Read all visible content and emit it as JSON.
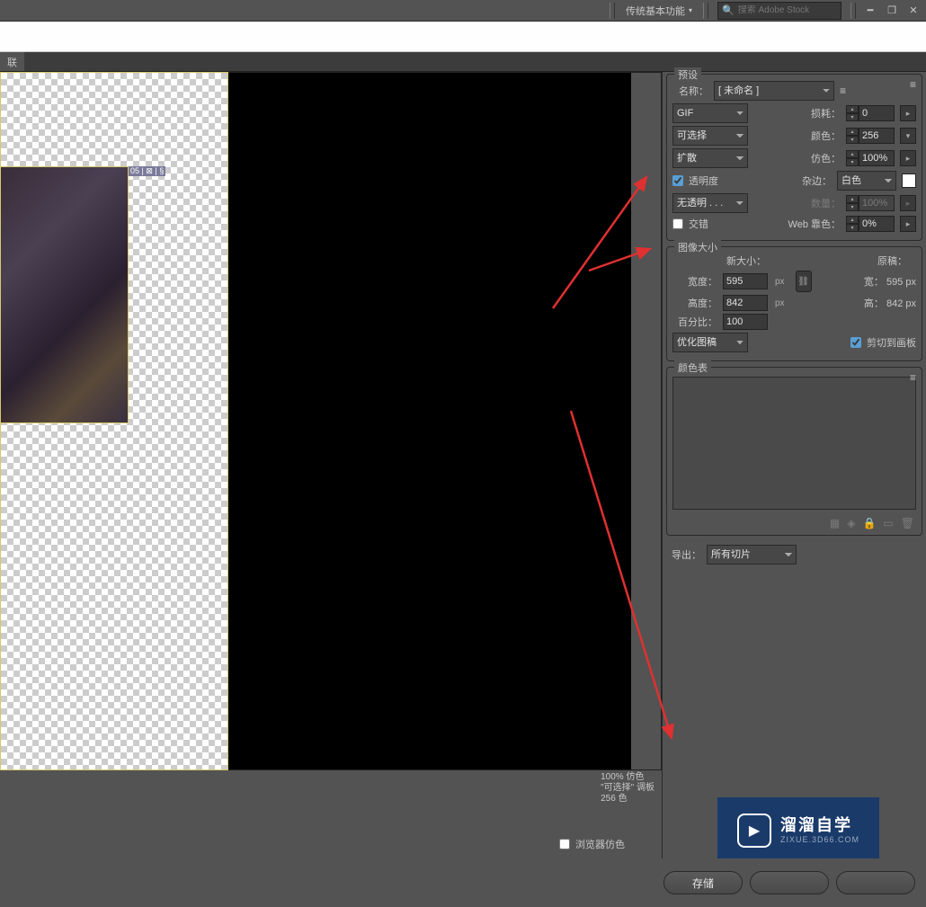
{
  "topbar": {
    "workspace": "传统基本功能",
    "search_placeholder": "搜索 Adobe Stock"
  },
  "tab": {
    "label": "联"
  },
  "canvas": {
    "slice_badge": "05 | ⊠ | §"
  },
  "canvasfoot": {
    "line1": "100% 仿色",
    "line2": "\"可选择\" 调板",
    "line3": "256 色"
  },
  "preset": {
    "title": "预设",
    "name_label": "名称：",
    "name_value": "[ 未命名 ]",
    "format": "GIF",
    "lossy_label": "损耗：",
    "lossy_value": "0",
    "reduction": "可选择",
    "colors_label": "颜色：",
    "colors_value": "256",
    "dither": "扩散",
    "dither_label": "仿色：",
    "dither_value": "100%",
    "transparency_label": "透明度",
    "matte_label": "杂边：",
    "matte_value": "白色",
    "trans_dither": "无透明 . . .",
    "amount_label": "数量：",
    "amount_value": "100%",
    "interlace_label": "交错",
    "web_label": "Web 靠色：",
    "web_value": "0%"
  },
  "imagesize": {
    "title": "图像大小",
    "newsize_label": "新大小：",
    "orig_label": "原稿：",
    "width_label": "宽度：",
    "width_value": "595",
    "height_label": "高度：",
    "height_value": "842",
    "percent_label": "百分比：",
    "percent_value": "100",
    "orig_width": "宽： 595 px",
    "orig_height": "高： 842 px",
    "optimize": "优化图稿",
    "clip_label": "剪切到画板",
    "px": "px"
  },
  "colortable": {
    "title": "颜色表"
  },
  "export": {
    "label": "导出：",
    "value": "所有切片"
  },
  "bottom": {
    "browser_dither": "浏览器仿色",
    "save": "存储"
  },
  "watermark": {
    "cn": "溜溜自学",
    "en": "ZIXUE.3D66.COM"
  }
}
